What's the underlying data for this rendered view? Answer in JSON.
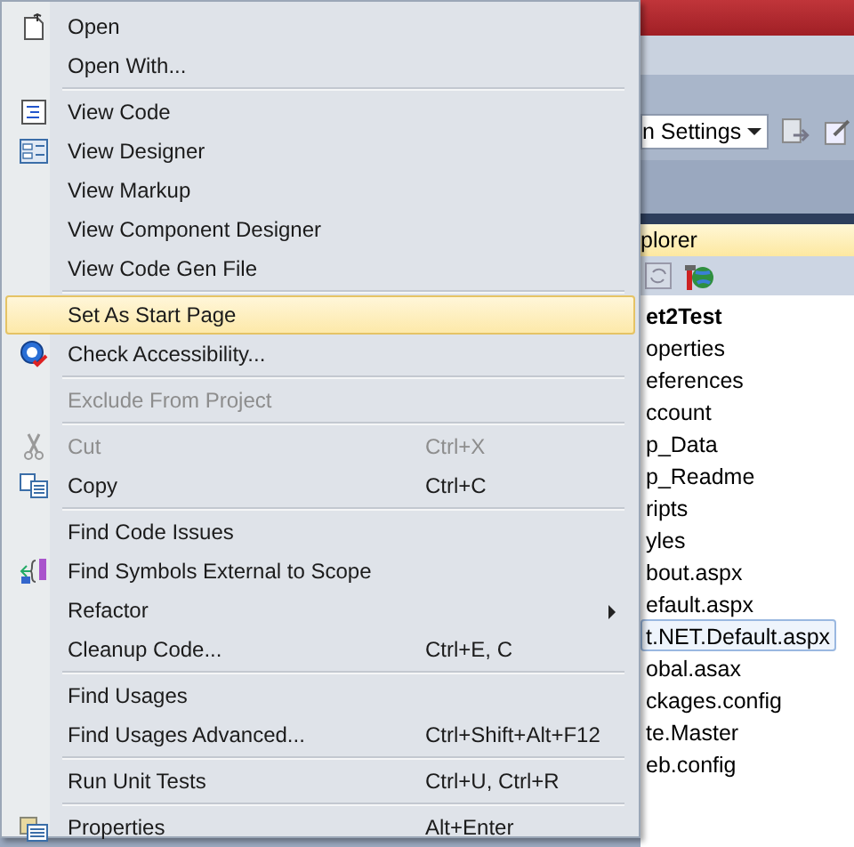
{
  "context_menu": {
    "items": [
      {
        "kind": "item",
        "label": "Open",
        "disabled": false,
        "selected": false,
        "submenu": false
      },
      {
        "kind": "item",
        "label": "Open With...",
        "disabled": false,
        "selected": false,
        "submenu": false
      },
      {
        "kind": "separator"
      },
      {
        "kind": "item",
        "label": "View Code",
        "disabled": false,
        "selected": false,
        "submenu": false
      },
      {
        "kind": "item",
        "label": "View Designer",
        "disabled": false,
        "selected": false,
        "submenu": false
      },
      {
        "kind": "item",
        "label": "View Markup",
        "disabled": false,
        "selected": false,
        "submenu": false
      },
      {
        "kind": "item",
        "label": "View Component Designer",
        "disabled": false,
        "selected": false,
        "submenu": false
      },
      {
        "kind": "item",
        "label": "View Code Gen File",
        "disabled": false,
        "selected": false,
        "submenu": false
      },
      {
        "kind": "separator"
      },
      {
        "kind": "item",
        "label": "Set As Start Page",
        "disabled": false,
        "selected": true,
        "submenu": false
      },
      {
        "kind": "item",
        "label": "Check Accessibility...",
        "disabled": false,
        "selected": false,
        "submenu": false
      },
      {
        "kind": "separator"
      },
      {
        "kind": "item",
        "label": "Exclude From Project",
        "disabled": true,
        "selected": false,
        "submenu": false
      },
      {
        "kind": "separator"
      },
      {
        "kind": "item",
        "label": "Cut",
        "shortcut": "Ctrl+X",
        "disabled": true,
        "selected": false,
        "submenu": false
      },
      {
        "kind": "item",
        "label": "Copy",
        "shortcut": "Ctrl+C",
        "disabled": false,
        "selected": false,
        "submenu": false
      },
      {
        "kind": "separator"
      },
      {
        "kind": "item",
        "label": "Find Code Issues",
        "disabled": false,
        "selected": false,
        "submenu": false
      },
      {
        "kind": "item",
        "label": "Find Symbols External to Scope",
        "disabled": false,
        "selected": false,
        "submenu": false
      },
      {
        "kind": "item",
        "label": "Refactor",
        "disabled": false,
        "selected": false,
        "submenu": true
      },
      {
        "kind": "item",
        "label": "Cleanup Code...",
        "shortcut": "Ctrl+E, C",
        "disabled": false,
        "selected": false,
        "submenu": false
      },
      {
        "kind": "separator"
      },
      {
        "kind": "item",
        "label": "Find Usages",
        "disabled": false,
        "selected": false,
        "submenu": false
      },
      {
        "kind": "item",
        "label": "Find Usages Advanced...",
        "shortcut": "Ctrl+Shift+Alt+F12",
        "disabled": false,
        "selected": false,
        "submenu": false
      },
      {
        "kind": "separator"
      },
      {
        "kind": "item",
        "label": "Run Unit Tests",
        "shortcut": "Ctrl+U, Ctrl+R",
        "disabled": false,
        "selected": false,
        "submenu": false
      },
      {
        "kind": "separator"
      },
      {
        "kind": "item",
        "label": "Properties",
        "shortcut": "Alt+Enter",
        "disabled": false,
        "selected": false,
        "submenu": false
      }
    ]
  },
  "toolbar": {
    "configuration_dropdown": "n Settings"
  },
  "solution_explorer": {
    "title": "plorer",
    "tree": [
      {
        "label": "et2Test",
        "selected": false,
        "children": [
          {
            "label": "operties",
            "selected": false
          },
          {
            "label": "eferences",
            "selected": false
          },
          {
            "label": "ccount",
            "selected": false
          },
          {
            "label": "p_Data",
            "selected": false
          },
          {
            "label": "p_Readme",
            "selected": false
          },
          {
            "label": "ripts",
            "selected": false
          },
          {
            "label": "yles",
            "selected": false
          },
          {
            "label": "bout.aspx",
            "selected": false
          },
          {
            "label": "efault.aspx",
            "selected": false
          },
          {
            "label": "t.NET.Default.aspx",
            "selected": true
          },
          {
            "label": "obal.asax",
            "selected": false
          },
          {
            "label": "ckages.config",
            "selected": false
          },
          {
            "label": "te.Master",
            "selected": false
          },
          {
            "label": "eb.config",
            "selected": false
          }
        ]
      }
    ]
  }
}
